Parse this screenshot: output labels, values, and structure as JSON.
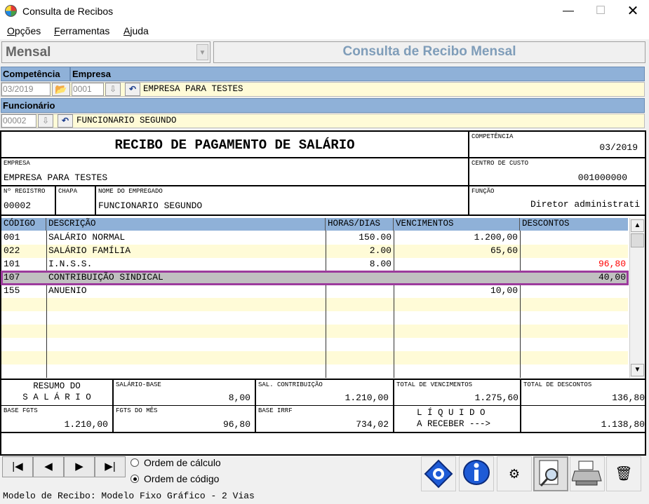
{
  "window": {
    "title": "Consulta de Recibos",
    "minimize": "—",
    "maximize": "☐",
    "close": "✕"
  },
  "menu": {
    "opcoes_u": "O",
    "opcoes_rest": "pções",
    "ferramentas_u": "F",
    "ferramentas_rest": "erramentas",
    "ajuda_u": "A",
    "ajuda_rest": "juda"
  },
  "mode": {
    "selected": "Mensal",
    "banner": "Consulta de Recibo Mensal"
  },
  "filters": {
    "competencia_label": "Competência",
    "empresa_label": "Empresa",
    "competencia_value": "03/2019",
    "empresa_code": "0001",
    "empresa_name": "EMPRESA PARA TESTES",
    "funcionario_label": "Funcionário",
    "funcionario_code": "00002",
    "funcionario_name": "FUNCIONARIO SEGUNDO"
  },
  "receipt": {
    "title": "RECIBO DE PAGAMENTO DE SALÁRIO",
    "competencia_label": "COMPETÊNCIA",
    "competencia_value": "03/2019",
    "empresa_label": "EMPRESA",
    "empresa_value": "EMPRESA PARA TESTES",
    "centro_label": "CENTRO DE CUSTO",
    "centro_value": "001000000",
    "registro_label": "Nº REGISTRO",
    "registro_value": "00002",
    "chapa_label": "CHAPA",
    "chapa_value": "",
    "nome_label": "NOME DO EMPREGADO",
    "nome_value": "FUNCIONARIO SEGUNDO",
    "funcao_label": "FUNÇÃO",
    "funcao_value": "Diretor administrati"
  },
  "items": {
    "headers": {
      "codigo": "CÓDIGO",
      "descricao": "DESCRIÇÃO",
      "horas": "HORAS/DIAS",
      "vencimentos": "VENCIMENTOS",
      "descontos": "DESCONTOS"
    },
    "rows": [
      {
        "codigo": "001",
        "descricao": "SALÁRIO NORMAL",
        "horas": "150.00",
        "vencimentos": "1.200,00",
        "descontos": ""
      },
      {
        "codigo": "022",
        "descricao": "SALÁRIO FAMÍLIA",
        "horas": "2.00",
        "vencimentos": "65,60",
        "descontos": ""
      },
      {
        "codigo": "101",
        "descricao": "I.N.S.S.",
        "horas": "8.00",
        "vencimentos": "",
        "descontos": "96,80"
      },
      {
        "codigo": "107",
        "descricao": "CONTRIBUIÇÃO SINDICAL",
        "horas": "",
        "vencimentos": "",
        "descontos": "40,00"
      },
      {
        "codigo": "155",
        "descricao": "ANUENIO",
        "horas": "",
        "vencimentos": "10,00",
        "descontos": ""
      }
    ],
    "colors": {
      "header": "#8fb1d8",
      "alt_row": "#fffbd7",
      "selected_row": "#c0c0c0",
      "highlight_border": "#9c3b9c",
      "negative": "#ff0000"
    }
  },
  "summary": {
    "resumo_1": "RESUMO DO",
    "resumo_2": "S A L Á R I O",
    "salario_base_label": "SALÁRIO-BASE",
    "salario_base_value": "8,00",
    "sal_contrib_label": "SAL. CONTRIBUIÇÃO",
    "sal_contrib_value": "1.210,00",
    "total_venc_label": "TOTAL DE VENCIMENTOS",
    "total_venc_value": "1.275,60",
    "total_desc_label": "TOTAL DE DESCONTOS",
    "total_desc_value": "136,80",
    "base_fgts_label": "BASE FGTS",
    "base_fgts_value": "1.210,00",
    "fgts_mes_label": "FGTS DO MÊS",
    "fgts_mes_value": "96,80",
    "base_irrf_label": "BASE IRRF",
    "base_irrf_value": "734,02",
    "liquido_1": "L Í Q U I D O",
    "liquido_2": "A RECEBER --->",
    "liquido_value": "1.138,80"
  },
  "nav": {
    "first": "|◀",
    "prev": "◀",
    "next": "▶",
    "last": "▶|"
  },
  "order": {
    "calculo": "Ordem de cálculo",
    "codigo": "Ordem de código",
    "selected": "codigo"
  },
  "status": "Modelo de Recibo: Modelo Fixo Gráfico - 2 Vias"
}
